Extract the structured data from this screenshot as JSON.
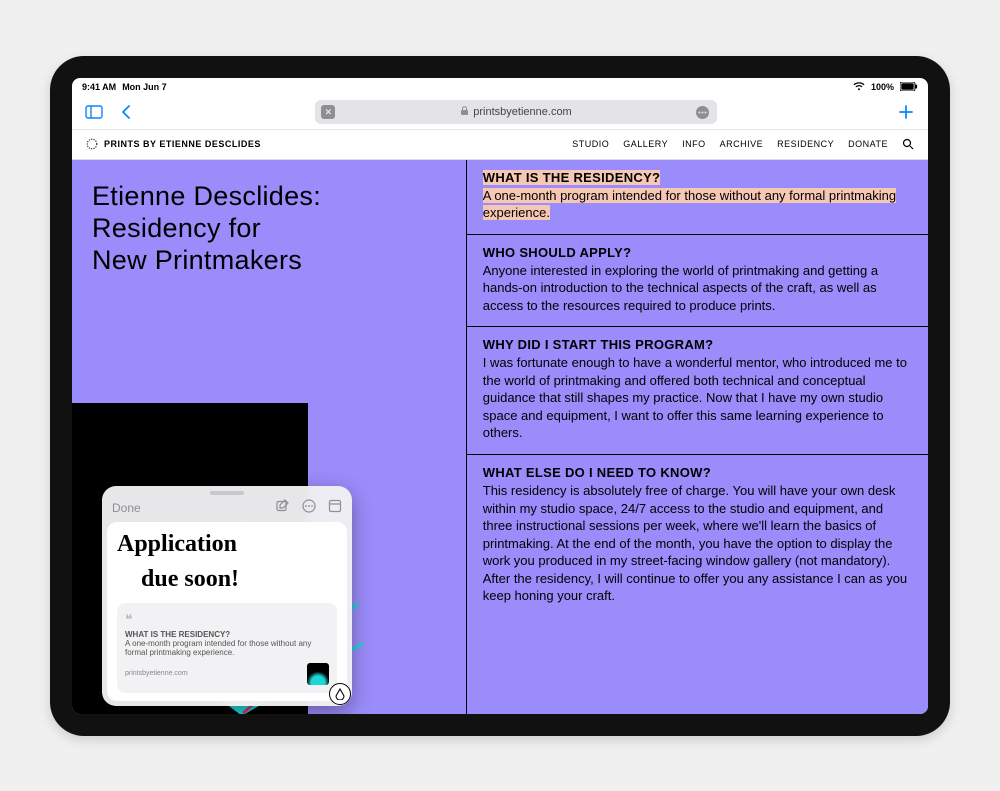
{
  "status": {
    "time": "9:41 AM",
    "date": "Mon Jun 7",
    "battery": "100%"
  },
  "safari": {
    "url": "printsbyetienne.com"
  },
  "site": {
    "brand": "PRINTS BY ETIENNE DESCLIDES",
    "nav": [
      "STUDIO",
      "GALLERY",
      "INFO",
      "ARCHIVE",
      "RESIDENCY",
      "DONATE"
    ]
  },
  "headline": "Etienne Desclides:\nResidency for\nNew Printmakers",
  "faq": [
    {
      "q": "WHAT IS THE RESIDENCY?",
      "a": "A one-month program intended for those without any formal printmaking experience.",
      "highlight": true
    },
    {
      "q": "WHO SHOULD APPLY?",
      "a": "Anyone interested in exploring the world of printmaking and getting a hands-on introduction to the technical aspects of the craft, as well as access to the resources required to produce prints."
    },
    {
      "q": "WHY DID I START THIS PROGRAM?",
      "a": "I was fortunate enough to have a wonderful mentor, who introduced me to the world of printmaking and offered both technical and conceptual guidance that still shapes my practice. Now that I have my own studio space and equipment, I want to offer this same learning experience to others."
    },
    {
      "q": "WHAT ELSE DO I NEED TO KNOW?",
      "a": "This residency is absolutely free of charge. You will have your own desk within my studio space, 24/7 access to the studio and equipment, and three instructional sessions per week, where we'll learn the basics of printmaking. At the end of the month, you have the option to display the work you produced in my street-facing window gallery (not mandatory). After the residency, I will continue to offer you any assistance I can as you keep honing your craft."
    }
  ],
  "quicknote": {
    "done": "Done",
    "handwriting1": "Application",
    "handwriting2": "due soon!",
    "quote_title": "WHAT IS THE RESIDENCY?",
    "quote_body": "A one-month program intended for those without any formal printmaking experience.",
    "quote_source": "printsbyetienne.com"
  }
}
